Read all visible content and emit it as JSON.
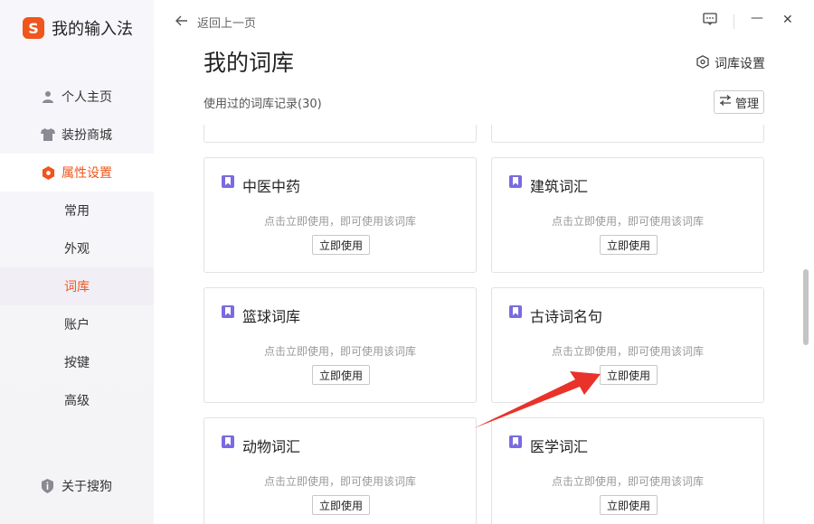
{
  "app": {
    "logo_letter": "S",
    "name": "我的输入法"
  },
  "sidebar": {
    "items": [
      {
        "label": "个人主页"
      },
      {
        "label": "装扮商城"
      },
      {
        "label": "属性设置"
      }
    ],
    "sub_items": [
      {
        "label": "常用"
      },
      {
        "label": "外观"
      },
      {
        "label": "词库"
      },
      {
        "label": "账户"
      },
      {
        "label": "按键"
      },
      {
        "label": "高级"
      }
    ],
    "about": "关于搜狗"
  },
  "header": {
    "back_label": "返回上一页",
    "title": "我的词库",
    "settings_label": "词库设置",
    "subtitle": "使用过的词库记录(30)",
    "manage_label": "管理"
  },
  "window": {
    "feedback_icon": "feedback-icon",
    "minimize": "—",
    "close": "✕"
  },
  "cards": [
    {
      "title": "中医中药",
      "desc": "点击立即使用，即可使用该词库",
      "button": "立即使用"
    },
    {
      "title": "建筑词汇",
      "desc": "点击立即使用，即可使用该词库",
      "button": "立即使用"
    },
    {
      "title": "篮球词库",
      "desc": "点击立即使用，即可使用该词库",
      "button": "立即使用"
    },
    {
      "title": "古诗词名句",
      "desc": "点击立即使用，即可使用该词库",
      "button": "立即使用"
    },
    {
      "title": "动物词汇",
      "desc": "点击立即使用，即可使用该词库",
      "button": "立即使用"
    },
    {
      "title": "医学词汇",
      "desc": "点击立即使用，即可使用该词库",
      "button": "立即使用"
    }
  ],
  "colors": {
    "accent": "#f0551c",
    "card_icon": "#7a6be0",
    "arrow": "#e8322a"
  }
}
